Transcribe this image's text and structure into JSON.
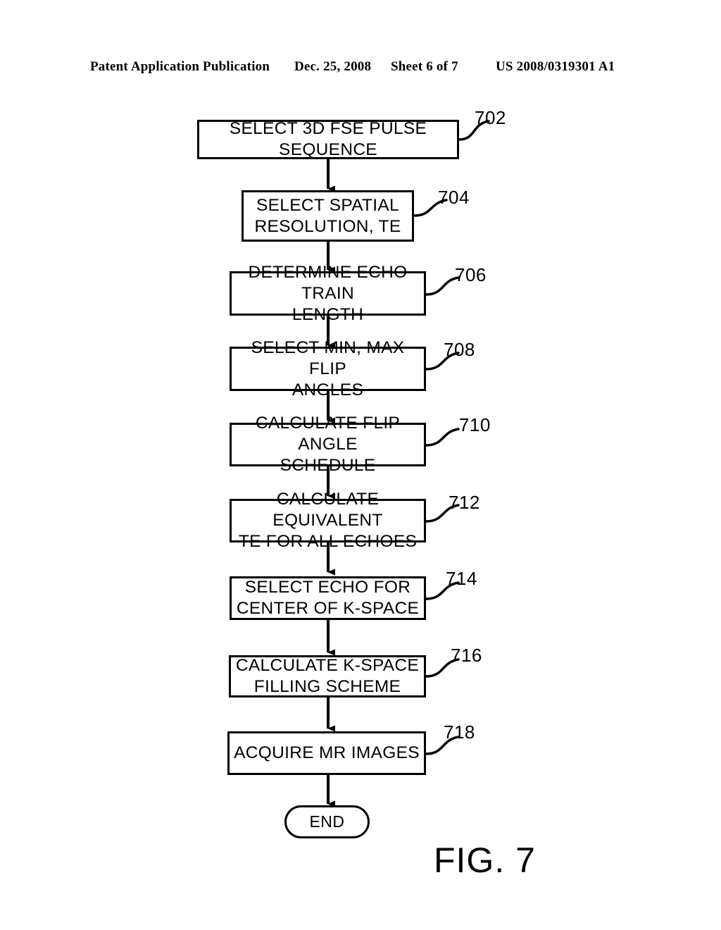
{
  "header": {
    "publication": "Patent Application Publication",
    "date": "Dec. 25, 2008",
    "sheet": "Sheet 6 of 7",
    "document_number": "US 2008/0319301 A1"
  },
  "figure": {
    "caption": "FIG. 7",
    "line_color": "#000000",
    "background_color": "#ffffff"
  },
  "flowchart": {
    "steps": [
      {
        "ref": "702",
        "label": "SELECT 3D FSE PULSE SEQUENCE"
      },
      {
        "ref": "704",
        "label": "SELECT SPATIAL\nRESOLUTION, TE"
      },
      {
        "ref": "706",
        "label": "DETERMINE ECHO TRAIN\nLENGTH"
      },
      {
        "ref": "708",
        "label": "SELECT MIN, MAX FLIP\nANGLES"
      },
      {
        "ref": "710",
        "label": "CALCULATE FLIP ANGLE\nSCHEDULE"
      },
      {
        "ref": "712",
        "label": "CALCULATE EQUIVALENT\nTE FOR ALL ECHOES"
      },
      {
        "ref": "714",
        "label": "SELECT ECHO FOR\nCENTER OF K-SPACE"
      },
      {
        "ref": "716",
        "label": "CALCULATE K-SPACE\nFILLING SCHEME"
      },
      {
        "ref": "718",
        "label": "ACQUIRE MR IMAGES"
      }
    ],
    "terminator": {
      "label": "END"
    }
  }
}
